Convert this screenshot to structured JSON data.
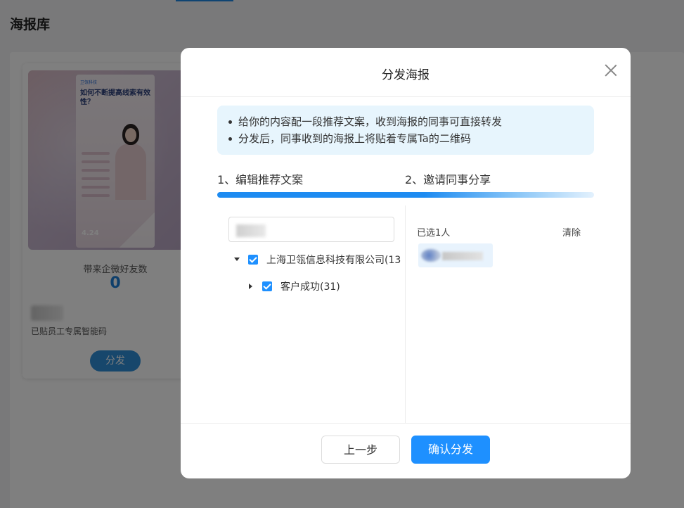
{
  "page": {
    "title": "海报库"
  },
  "poster_card": {
    "poster_logo": "卫瓴科技",
    "poster_headline": "如何不断提高线索有效性？",
    "poster_date": "4.24",
    "friend_label": "带来企微好友数",
    "friend_count": "0",
    "code_label": "已贴员工专属智能码",
    "share_button": "分发"
  },
  "modal": {
    "title": "分发海报",
    "tips": [
      "给你的内容配一段推荐文案，收到海报的同事可直接转发",
      "分发后，同事收到的海报上将贴着专属Ta的二维码"
    ],
    "steps": [
      "1、编辑推荐文案",
      "2、邀请同事分享"
    ],
    "progress_percent": 55,
    "search": {
      "value": "",
      "placeholder": ""
    },
    "tree": [
      {
        "label": "上海卫瓴信息科技有限公司(13",
        "expanded": true,
        "checked": true
      },
      {
        "label": "客户成功(31)",
        "expanded": false,
        "checked": true
      }
    ],
    "selected_label": "已选1人",
    "clear_label": "清除",
    "prev_button": "上一步",
    "confirm_button": "确认分发"
  },
  "colors": {
    "accent": "#1e90ff",
    "tip_background": "#e7f5fd",
    "share_button": "#2f8fd8"
  }
}
